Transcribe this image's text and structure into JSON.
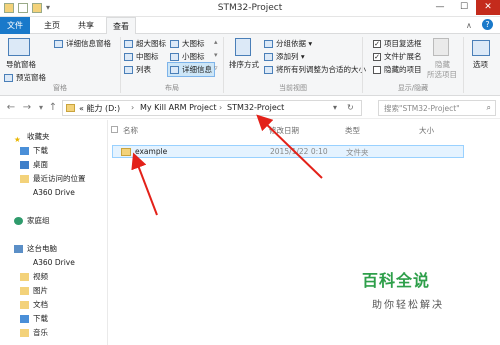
{
  "window": {
    "title": "STM32-Project"
  },
  "tabs": [
    {
      "label": "文件"
    },
    {
      "label": "主页"
    },
    {
      "label": "共享"
    },
    {
      "label": "查看"
    }
  ],
  "ribbon": {
    "pane_group": {
      "label": "窗格",
      "nav_pane": "导航窗格",
      "preview_pane": "预览窗格",
      "details_pane": "详细信息窗格"
    },
    "layout_group": {
      "label": "布局",
      "extra_large": "超大图标",
      "large": "大图标",
      "medium": "中图标",
      "small": "小图标",
      "list": "列表",
      "details": "详细信息"
    },
    "view_group": {
      "label": "当前视图",
      "sort_by": "排序方式",
      "group_by": "分组依据",
      "add_columns": "添加列",
      "fit_columns": "将所有列调整为合适的大小"
    },
    "showhide_group": {
      "label": "显示/隐藏",
      "item_checkboxes": "项目复选框",
      "file_ext": "文件扩展名",
      "hidden_items": "隐藏的项目",
      "hide_selected": "隐藏",
      "hide_selected2": "所选项目"
    },
    "options": "选项"
  },
  "address": {
    "crumbs": [
      "« 能力 (D:)",
      "My Kill ARM Project",
      "STM32-Project"
    ],
    "search_placeholder": "搜索\"STM32-Project\""
  },
  "nav": [
    {
      "label": "收藏夹",
      "icon": "star-icon"
    },
    {
      "label": "下载",
      "icon": "download-folder-icon"
    },
    {
      "label": "桌面",
      "icon": "desktop-icon"
    },
    {
      "label": "最近访问的位置",
      "icon": "recent-places-icon"
    },
    {
      "label": "A360 Drive",
      "icon": "none"
    },
    {
      "label": "家庭组",
      "icon": "homegroup-icon"
    },
    {
      "label": "这台电脑",
      "icon": "computer-icon"
    },
    {
      "label": "A360 Drive",
      "icon": "none"
    },
    {
      "label": "视频",
      "icon": "video-folder-icon"
    },
    {
      "label": "图片",
      "icon": "pictures-folder-icon"
    },
    {
      "label": "文档",
      "icon": "documents-folder-icon"
    },
    {
      "label": "下载",
      "icon": "download-folder-icon"
    },
    {
      "label": "音乐",
      "icon": "music-folder-icon"
    }
  ],
  "columns": {
    "name": "名称",
    "date": "修改日期",
    "type": "类型",
    "size": "大小"
  },
  "files": [
    {
      "name": "example",
      "date": "2015/1/22 0:10",
      "type": "文件夹",
      "size": ""
    }
  ],
  "watermark": {
    "line1": "百科全说",
    "line2": "助你轻松解决"
  },
  "colors": {
    "accent": "#1979ca",
    "annotation_arrow": "#e32119",
    "watermark": "#2e9f4a"
  }
}
